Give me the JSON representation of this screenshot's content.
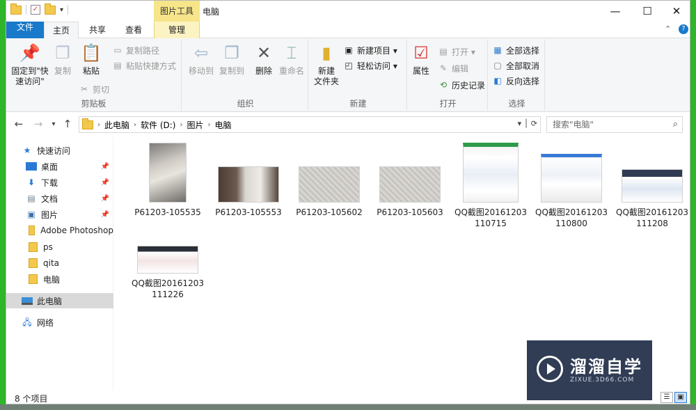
{
  "window": {
    "context_tab_header": "图片工具",
    "title": "电脑",
    "controls": {
      "minimize": "—",
      "maximize": "☐",
      "close": "✕"
    },
    "qat_arrow": "▾"
  },
  "tabs": [
    {
      "label": "文件"
    },
    {
      "label": "主页"
    },
    {
      "label": "共享"
    },
    {
      "label": "查看"
    },
    {
      "label": "管理"
    }
  ],
  "tabs_right": {
    "collapse": "⌃",
    "help": "?"
  },
  "ribbon": {
    "clipboard": {
      "label": "剪贴板",
      "pin": "固定到\"快\n速访问\"",
      "copy": "复制",
      "paste": "粘贴",
      "copy_path": "复制路径",
      "paste_shortcut": "粘贴快捷方式",
      "cut": "剪切"
    },
    "organize": {
      "label": "组织",
      "move_to": "移动到",
      "copy_to": "复制到",
      "delete": "删除",
      "rename": "重命名"
    },
    "new": {
      "label": "新建",
      "new_folder": "新建\n文件夹",
      "new_item": "新建项目 ▾",
      "easy_access": "轻松访问 ▾"
    },
    "open": {
      "label": "打开",
      "properties": "属性",
      "open": "打开 ▾",
      "edit": "编辑",
      "history": "历史记录"
    },
    "select": {
      "label": "选择",
      "select_all": "全部选择",
      "select_none": "全部取消",
      "invert": "反向选择"
    }
  },
  "address": {
    "crumbs": [
      "此电脑",
      "软件 (D:)",
      "图片",
      "电脑"
    ],
    "search_placeholder": "搜索\"电脑\""
  },
  "nav": {
    "quick_access": "快速访问",
    "items": [
      {
        "label": "桌面",
        "pinned": true
      },
      {
        "label": "下载",
        "pinned": true
      },
      {
        "label": "文档",
        "pinned": true
      },
      {
        "label": "图片",
        "pinned": true
      },
      {
        "label": "Adobe Photoshop",
        "pinned": false
      },
      {
        "label": "ps",
        "pinned": false
      },
      {
        "label": "qita",
        "pinned": false
      },
      {
        "label": "电脑",
        "pinned": false
      }
    ],
    "this_pc": "此电脑",
    "network": "网络"
  },
  "files": [
    {
      "name": "P61203-105535"
    },
    {
      "name": "P61203-105553"
    },
    {
      "name": "P61203-105602"
    },
    {
      "name": "P61203-105603"
    },
    {
      "name": "QQ截图20161203110715"
    },
    {
      "name": "QQ截图20161203110800"
    },
    {
      "name": "QQ截图20161203111208"
    },
    {
      "name": "QQ截图20161203111226"
    }
  ],
  "status": {
    "count": "8 个项目"
  },
  "watermark": {
    "title": "溜溜自学",
    "subtitle": "ZIXUE.3D66.COM"
  }
}
